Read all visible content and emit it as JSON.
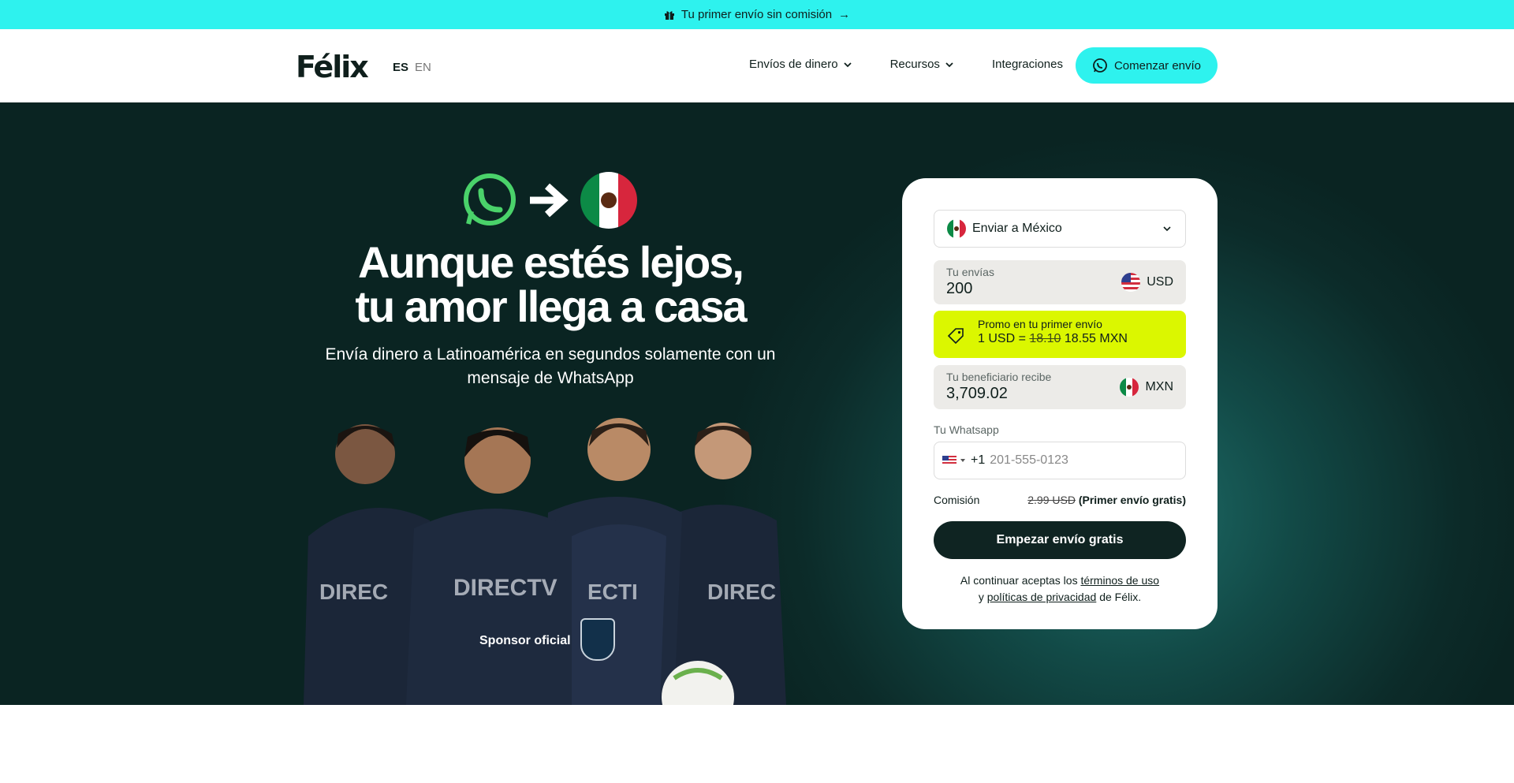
{
  "promo_bar": {
    "text": "Tu primer envío sin comisión",
    "arrow": "→"
  },
  "header": {
    "logo": "Félix",
    "lang_es": "ES",
    "lang_en": "EN",
    "nav": [
      {
        "label": "Envíos de dinero"
      },
      {
        "label": "Recursos"
      },
      {
        "label": "Integraciones"
      }
    ],
    "cta": "Comenzar envío"
  },
  "hero": {
    "title_line1": "Aunque estés lejos,",
    "title_line2": "tu amor llega a casa",
    "subtitle": "Envía dinero a Latinoamérica en segundos solamente con un mensaje de WhatsApp",
    "sponsor": "Sponsor oficial"
  },
  "form": {
    "destination": "Enviar a México",
    "send_label": "Tu envías",
    "send_value": "200",
    "send_currency": "USD",
    "promo_title": "Promo en tu primer envío",
    "promo_rate_prefix": "1 USD =",
    "promo_old_rate": "18.10",
    "promo_new_rate": "18.55",
    "promo_currency": "MXN",
    "receive_label": "Tu beneficiario recibe",
    "receive_value": "3,709.02",
    "receive_currency": "MXN",
    "whatsapp_label": "Tu Whatsapp",
    "phone_prefix": "+1",
    "phone_placeholder": "201-555-0123",
    "fee_label": "Comisión",
    "fee_old": "2.99 USD",
    "fee_free": "(Primer envío gratis)",
    "submit": "Empezar envío gratis",
    "legal_prefix": "Al continuar aceptas los",
    "legal_terms": "términos de uso",
    "legal_and": "y",
    "legal_privacy": "políticas de privacidad",
    "legal_suffix": "de Félix."
  },
  "colors": {
    "accent": "#2ef2ee",
    "promo": "#dbf700",
    "dark": "#0f2422"
  }
}
